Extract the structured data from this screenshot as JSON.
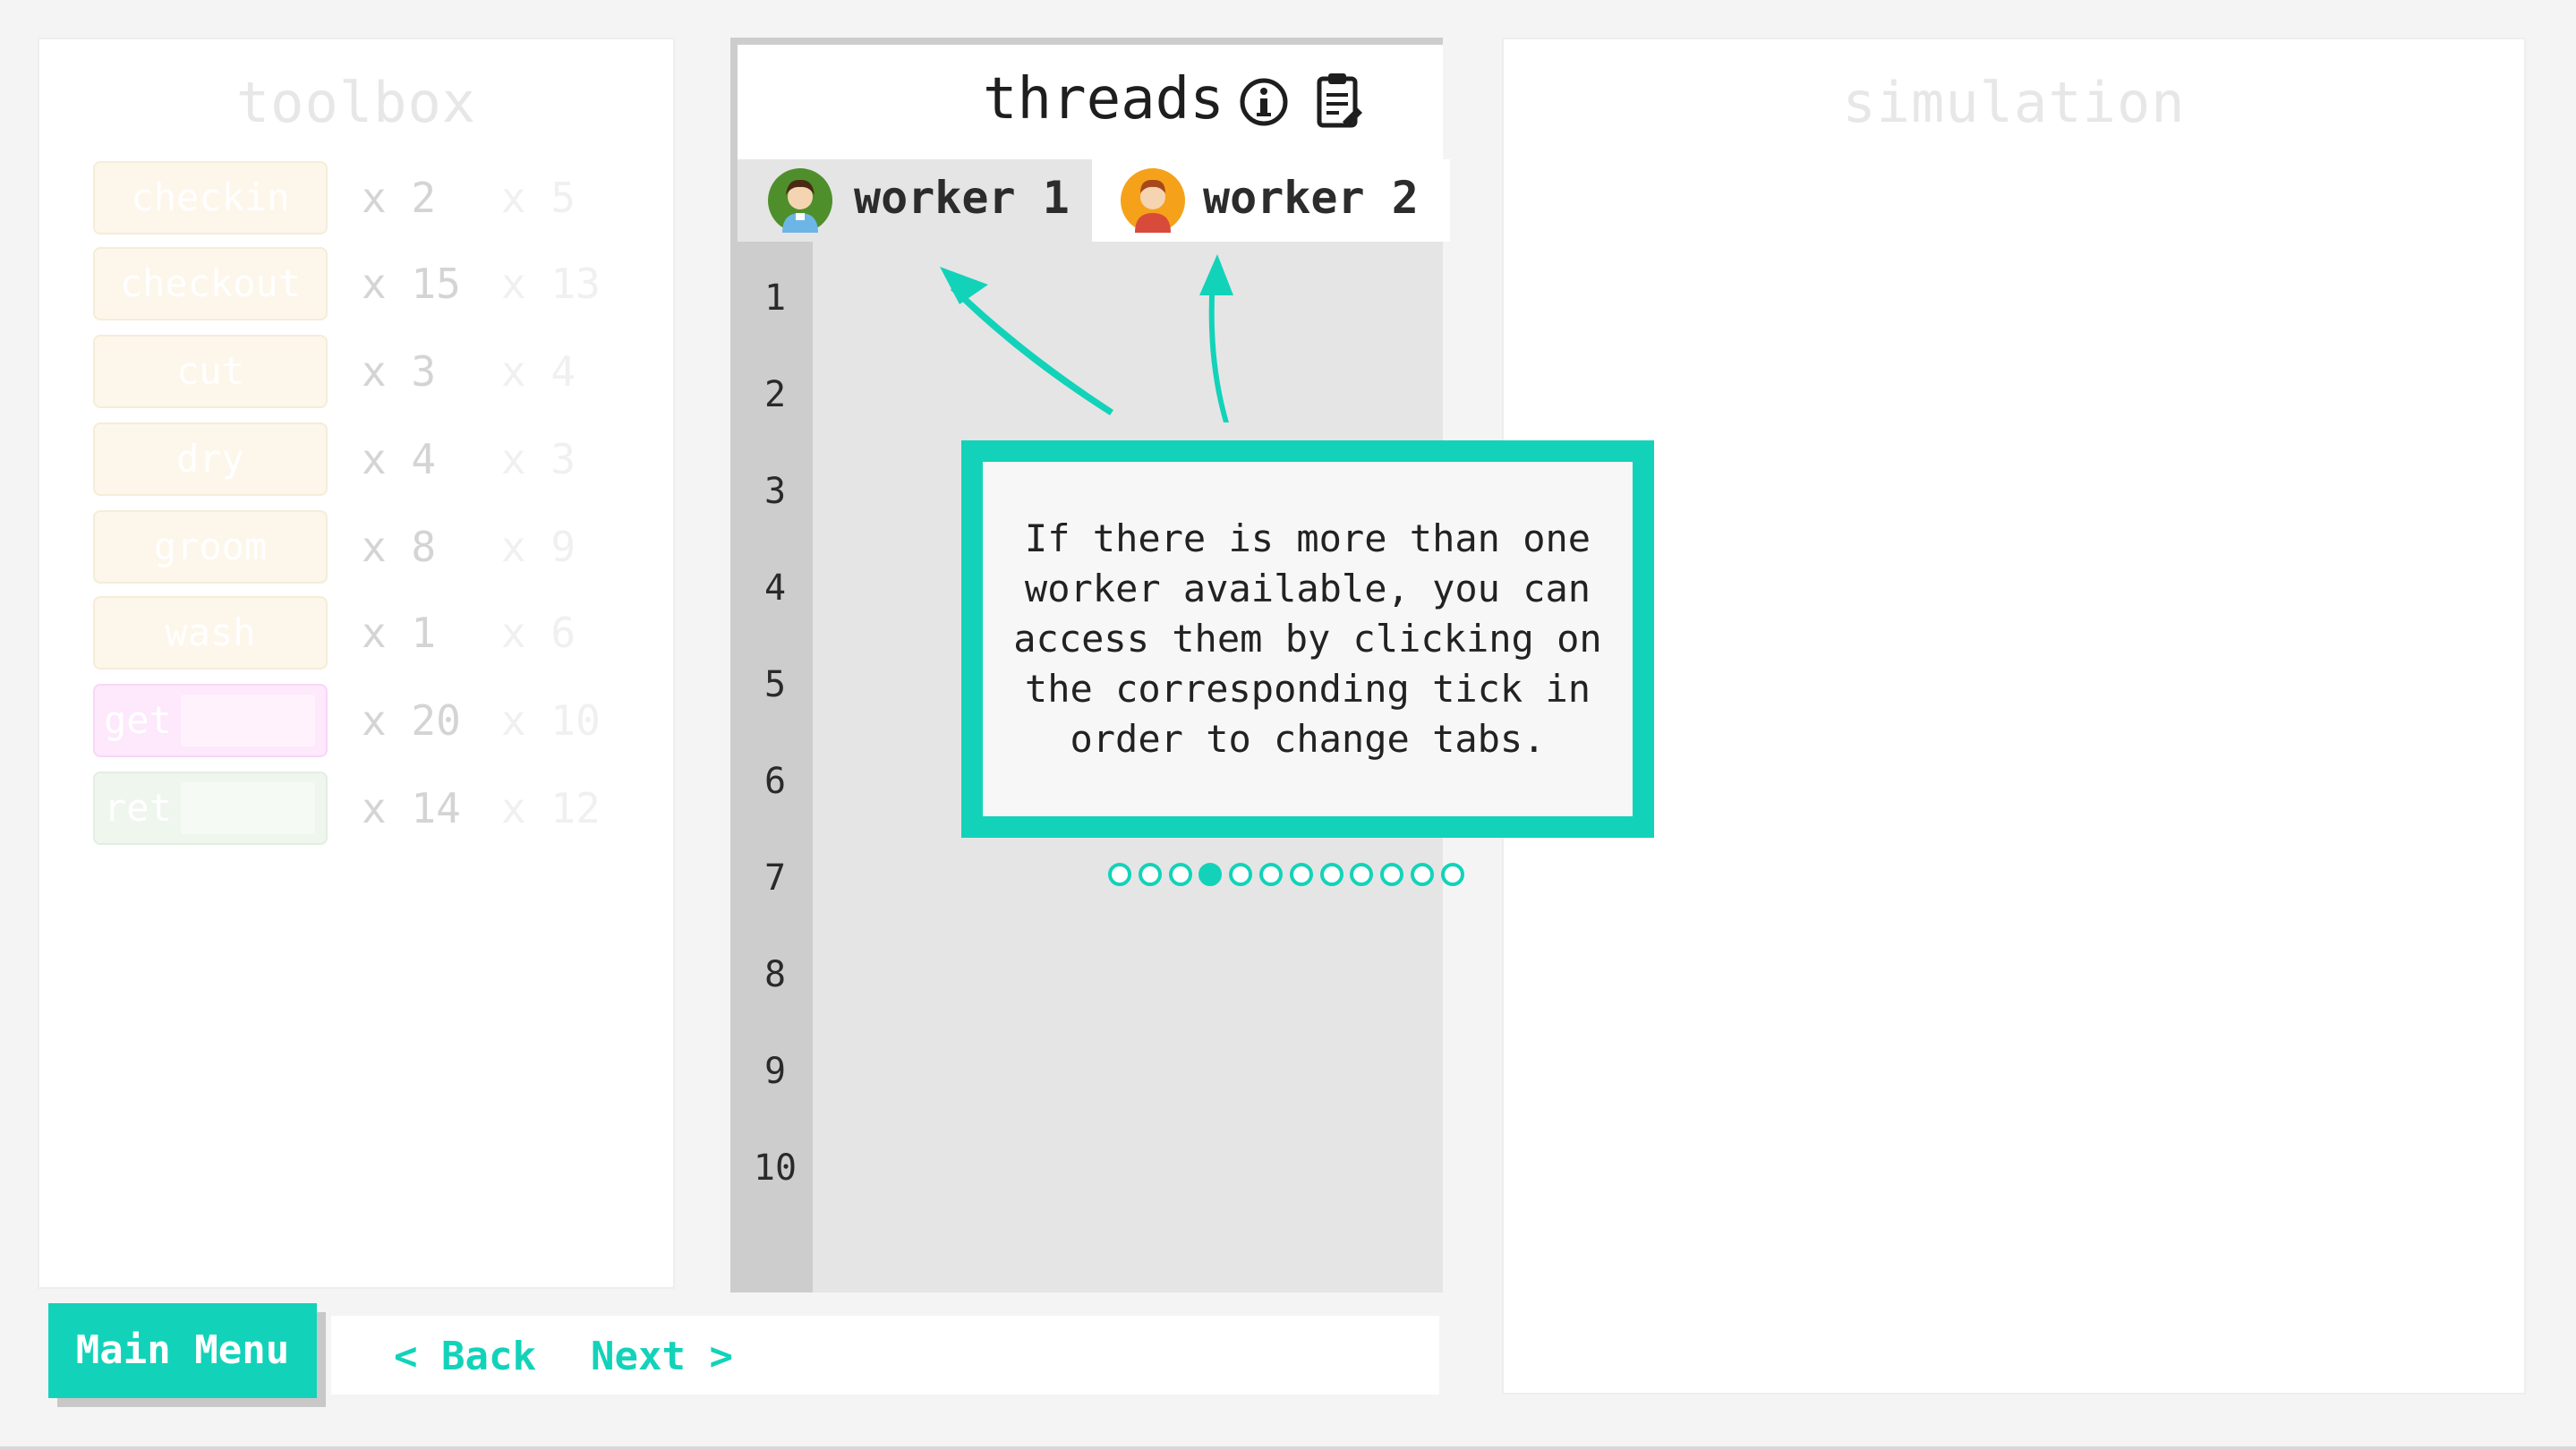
{
  "toolbox": {
    "title": "toolbox",
    "tools": [
      {
        "label": "checkin",
        "count": "x 2",
        "count_faded": "x 5",
        "style": "plain"
      },
      {
        "label": "checkout",
        "count": "x 15",
        "count_faded": "x 13",
        "style": "plain"
      },
      {
        "label": "cut",
        "count": "x 3",
        "count_faded": "x 4",
        "style": "plain"
      },
      {
        "label": "dry",
        "count": "x 4",
        "count_faded": "x 3",
        "style": "plain"
      },
      {
        "label": "groom",
        "count": "x 8",
        "count_faded": "x 9",
        "style": "plain"
      },
      {
        "label": "wash",
        "count": "x 1",
        "count_faded": "x 6",
        "style": "plain"
      },
      {
        "label": "get",
        "count": "x 20",
        "count_faded": "x 10",
        "style": "pink"
      },
      {
        "label": "ret",
        "count": "x 14",
        "count_faded": "x 12",
        "style": "green"
      }
    ]
  },
  "nav": {
    "main_menu": "Main Menu",
    "back": "< Back",
    "next": "Next >"
  },
  "threads": {
    "title": "threads",
    "tabs": [
      {
        "label": "worker 1",
        "active": true
      },
      {
        "label": "worker 2",
        "active": false
      }
    ],
    "line_numbers": [
      "1",
      "2",
      "3",
      "4",
      "5",
      "6",
      "7",
      "8",
      "9",
      "10"
    ]
  },
  "simulation": {
    "title": "simulation"
  },
  "tutorial": {
    "text": "If there is more than one worker available, you can access them by clicking on the corresponding tick in order to change tabs.",
    "step_count": 12,
    "active_step": 4,
    "accent": "#12d3b9"
  },
  "icons": [
    "info-icon",
    "clipboard-icon",
    "worker-avatar-icon"
  ]
}
